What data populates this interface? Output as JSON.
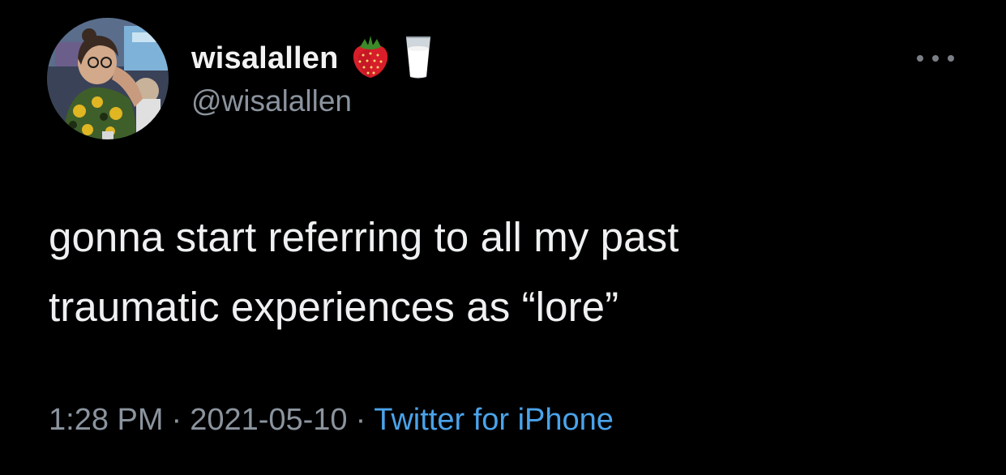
{
  "tweet": {
    "display_name": "wisalallen",
    "name_emojis": [
      "strawberry-emoji",
      "milk-glass-emoji"
    ],
    "handle": "@wisalallen",
    "text_lines": [
      "gonna start referring to all my past",
      "traumatic experiences as “lore”"
    ],
    "time": "1:28 PM",
    "date": "2021-05-10",
    "separator": "·",
    "source": "Twitter for iPhone"
  },
  "colors": {
    "background": "#000000",
    "text": "#eef0f1",
    "muted": "#8b949e",
    "link": "#4aa3ea"
  },
  "icons": {
    "more": "more-options-icon"
  }
}
